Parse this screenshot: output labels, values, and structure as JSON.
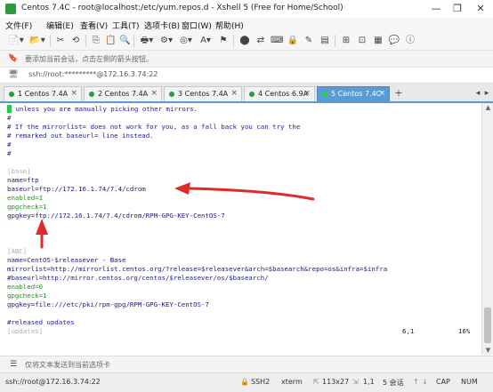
{
  "window": {
    "title": "Centos 7.4C - root@localhost:/etc/yum.repos.d - Xshell 5 (Free for Home/School)",
    "controls": [
      "—",
      "❐",
      "✕"
    ]
  },
  "menu": {
    "items": [
      "文件(F)",
      "编辑(E)",
      "查看(V)",
      "工具(T)",
      "选项卡(B)",
      "窗口(W)",
      "帮助(H)"
    ]
  },
  "hint": {
    "text": "要添加当前会话，点击左侧的箭头按钮。"
  },
  "address": {
    "text": "ssh://root:*********@172.16.3.74:22"
  },
  "tabs": [
    {
      "label": "1 Centos 7.4A",
      "active": false
    },
    {
      "label": "2 Centos 7.4A",
      "active": false
    },
    {
      "label": "3 Centos 7.4A",
      "active": false
    },
    {
      "label": "4 Centos 6.9A",
      "active": false
    },
    {
      "label": "5 Centos 7.4C",
      "active": true
    }
  ],
  "tab_add": "+",
  "terminal": {
    "lines": [
      {
        "text": "# unless you are manually picking other mirrors.",
        "cls": "c-comment"
      },
      {
        "text": "#",
        "cls": "c-comment"
      },
      {
        "text": "# If the mirrorlist= does not work for you, as a fall back you can try the",
        "cls": "c-comment"
      },
      {
        "text": "# remarked out baseurl= line instead.",
        "cls": "c-comment"
      },
      {
        "text": "#",
        "cls": "c-comment"
      },
      {
        "text": "#",
        "cls": "c-comment"
      },
      {
        "text": "",
        "cls": "c-dark"
      },
      {
        "text": "[base]",
        "cls": "c-section"
      },
      {
        "text": "name=ftp",
        "cls": "c-key"
      },
      {
        "text": "baseurl=ftp://172.16.1.74/7.4/cdrom",
        "cls": "c-key"
      },
      {
        "text": "enabled=1",
        "cls": "c-green"
      },
      {
        "text": "gpgcheck=1",
        "cls": "c-green"
      },
      {
        "text": "gpgkey=ftp://172.16.1.74/7.4/cdrom/RPM-GPG-KEY-CentOS-7",
        "cls": "c-key"
      },
      {
        "text": "",
        "cls": "c-dark"
      },
      {
        "text": "",
        "cls": "c-dark"
      },
      {
        "text": "",
        "cls": "c-dark"
      },
      {
        "text": "[ABC]",
        "cls": "c-section"
      },
      {
        "text": "name=CentOS-$releasever - Base",
        "cls": "c-key"
      },
      {
        "text": "mirrorlist=http://mirrorlist.centos.org/?release=$releasever&arch=$basearch&repo=os&infra=$infra",
        "cls": "c-key"
      },
      {
        "text": "#baseurl=http://mirror.centos.org/centos/$releasever/os/$basearch/",
        "cls": "c-comment"
      },
      {
        "text": "enabled=0",
        "cls": "c-green"
      },
      {
        "text": "gpgcheck=1",
        "cls": "c-green"
      },
      {
        "text": "gpgkey=file:///etc/pki/rpm-gpg/RPM-GPG-KEY-CentOS-7",
        "cls": "c-key"
      },
      {
        "text": "",
        "cls": "c-dark"
      },
      {
        "text": "#released updates",
        "cls": "c-comment"
      },
      {
        "text": "[updates]",
        "cls": "c-section"
      }
    ],
    "position": "6,1",
    "percent": "16%"
  },
  "sendbar": {
    "text": "仅将文本发送到当前选项卡"
  },
  "status": {
    "connection": "ssh://root@172.16.3.74:22",
    "protocol": "SSH2",
    "terminal": "xterm",
    "size": "113x27",
    "cursor": "1,1",
    "sessions": "5 会话",
    "cap": "CAP",
    "num": "NUM"
  },
  "annotation_color": "#e02a2a"
}
